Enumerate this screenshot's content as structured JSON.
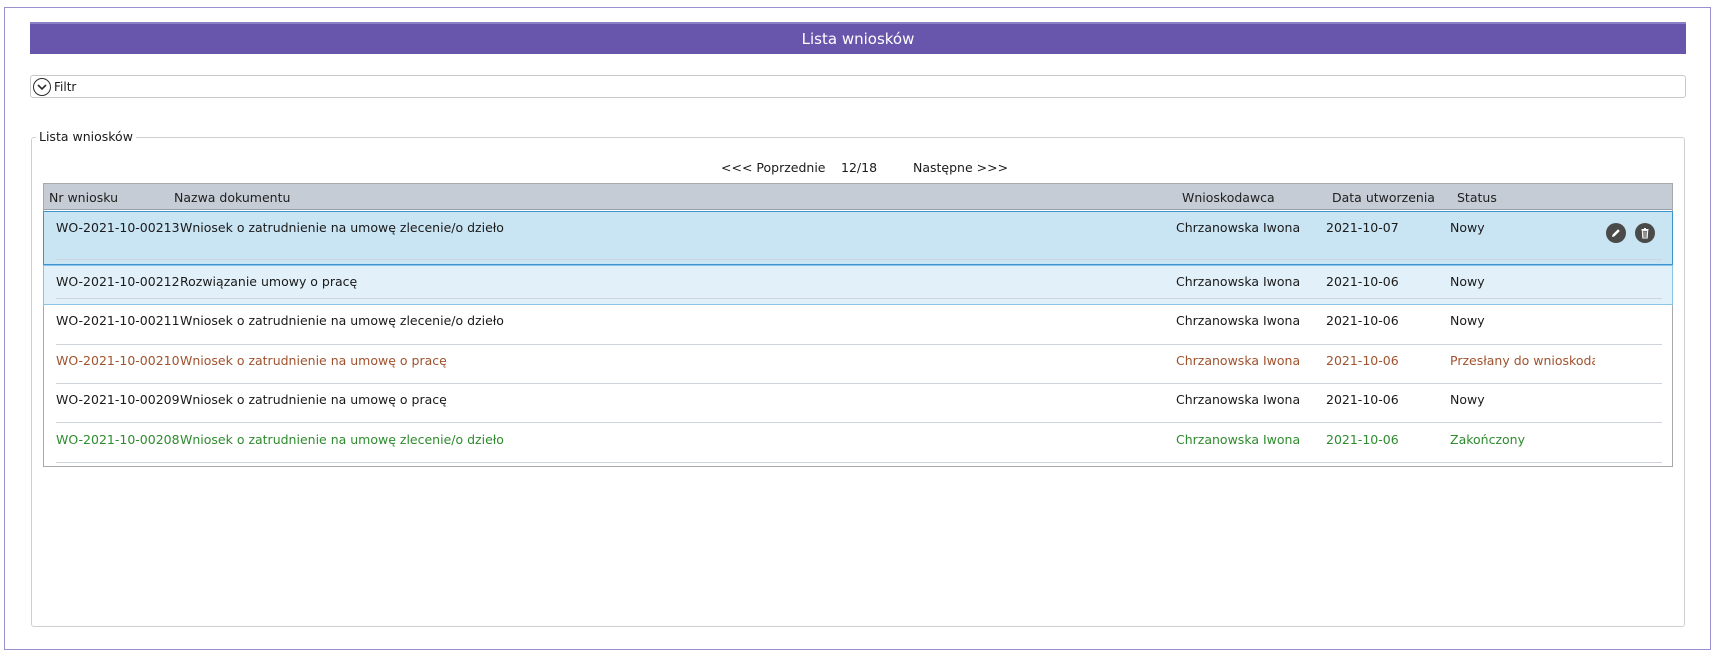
{
  "window": {
    "title": "Lista wniosków"
  },
  "filter": {
    "label": "Filtr",
    "icon": "chevron-down-circle-icon"
  },
  "list": {
    "legend": "Lista wniosków",
    "pager": {
      "prev_label": "<<< Poprzednie",
      "page": "12/18",
      "next_label": "Następne >>>"
    },
    "columns": {
      "nr": "Nr wniosku",
      "name": "Nazwa dokumentu",
      "applicant": "Wnioskodawca",
      "date": "Data utworzenia",
      "status": "Status"
    },
    "rows": [
      {
        "nr": "WO-2021-10-00213",
        "name": "Wniosek o zatrudnienie na umowę zlecenie/o dzieło",
        "applicant": "Chrzanowska Iwona",
        "date": "2021-10-07",
        "status": "Nowy"
      },
      {
        "nr": "WO-2021-10-00212",
        "name": "Rozwiązanie umowy o pracę",
        "applicant": "Chrzanowska Iwona",
        "date": "2021-10-06",
        "status": "Nowy"
      },
      {
        "nr": "WO-2021-10-00211",
        "name": "Wniosek o zatrudnienie na umowę zlecenie/o dzieło",
        "applicant": "Chrzanowska Iwona",
        "date": "2021-10-06",
        "status": "Nowy"
      },
      {
        "nr": "WO-2021-10-00210",
        "name": "Wniosek o zatrudnienie na umowę o pracę",
        "applicant": "Chrzanowska Iwona",
        "date": "2021-10-06",
        "status": "Przesłany do wnioskodawcy"
      },
      {
        "nr": "WO-2021-10-00209",
        "name": "Wniosek o zatrudnienie na umowę o pracę",
        "applicant": "Chrzanowska Iwona",
        "date": "2021-10-06",
        "status": "Nowy"
      },
      {
        "nr": "WO-2021-10-00208",
        "name": "Wniosek o zatrudnienie na umowę zlecenie/o dzieło",
        "applicant": "Chrzanowska Iwona",
        "date": "2021-10-06",
        "status": "Zakończony"
      }
    ],
    "row_actions": {
      "edit_icon": "pencil-icon",
      "delete_icon": "trash-icon"
    }
  },
  "colors": {
    "title_bar": "#6756ab",
    "header_bg": "#c6ccd6",
    "selected_row": "#c9e4f3",
    "hover_row": "#e2f1f9",
    "status_sent": "#a0522d",
    "status_done": "#2e8b2e"
  }
}
